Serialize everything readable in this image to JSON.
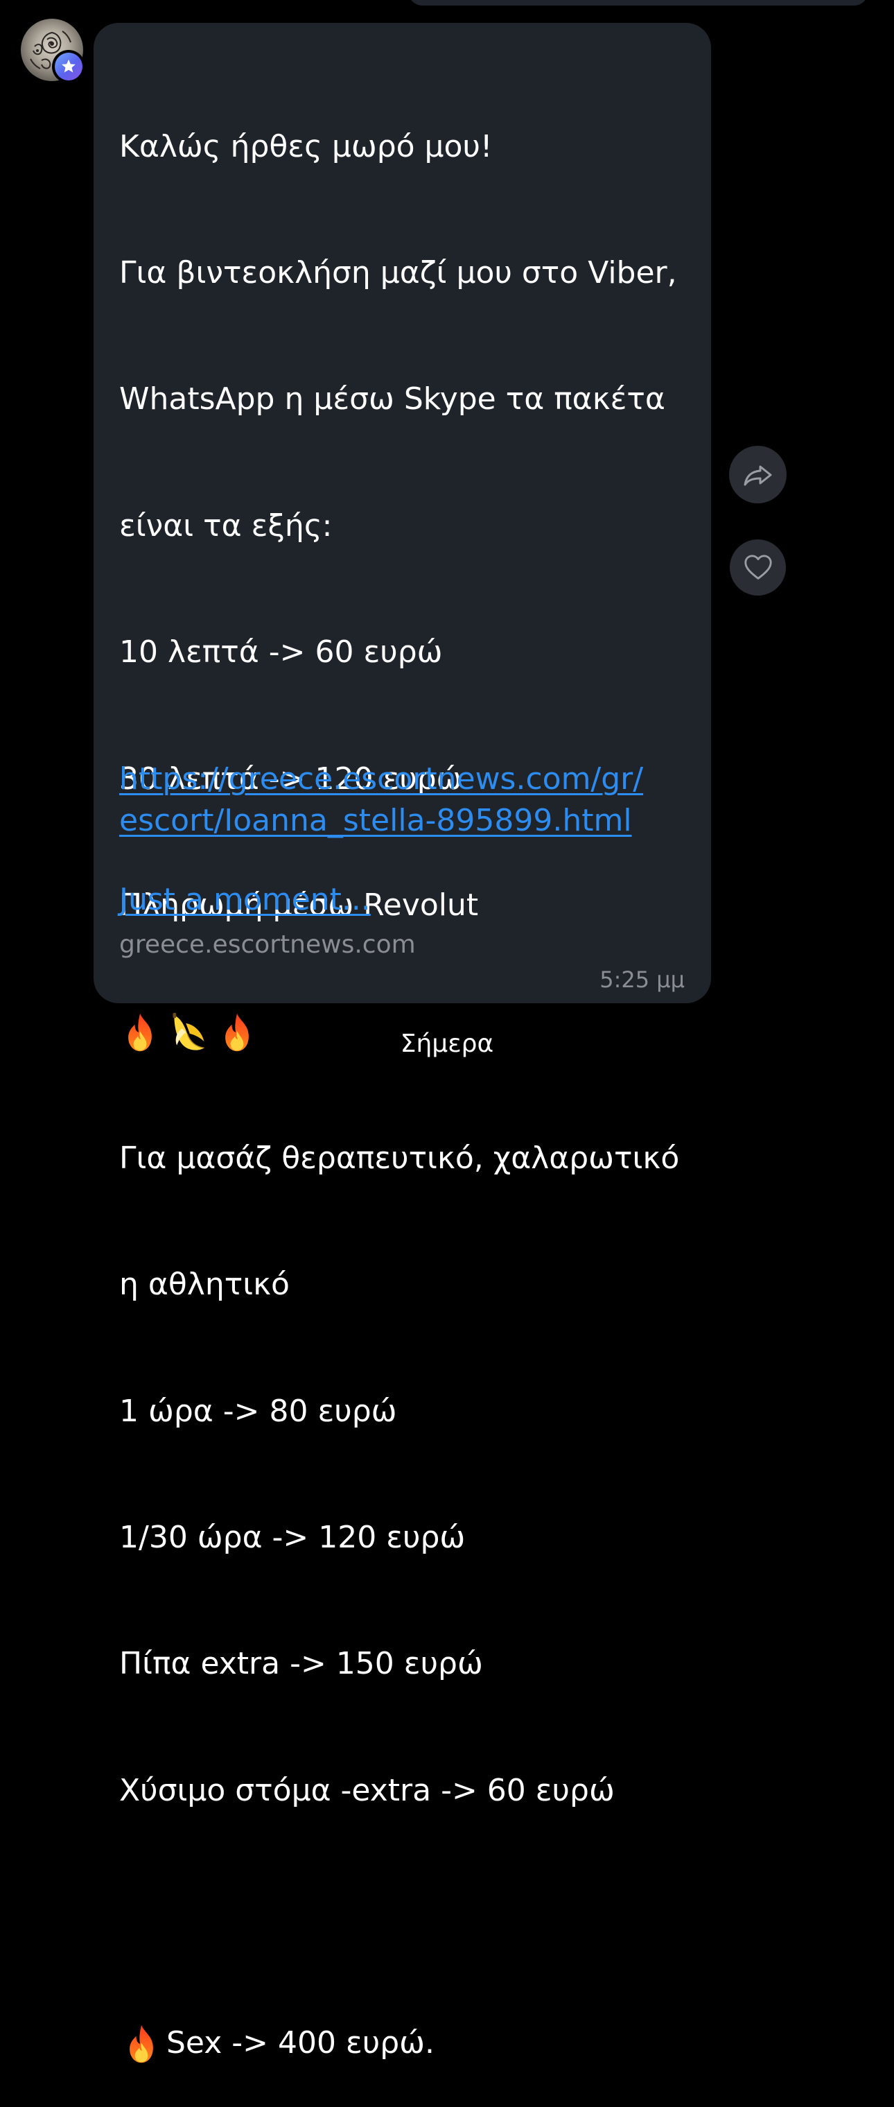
{
  "message": {
    "lines": [
      "Καλώς ήρθες μωρό μου!",
      "Για βιντεοκλήση μαζί μου στο Viber,",
      "WhatsApp η μέσω Skype τα πακέτα",
      "είναι τα εξής:",
      "10 λεπτά -> 60 ευρώ",
      "30 λεπτά -> 120 ευρώ",
      "Πληρωμή μέσω Revolut"
    ],
    "emoji_row": [
      "fire",
      "banana",
      "fire"
    ],
    "lines2": [
      "Για μασάζ θεραπευτικό, χαλαρωτικό",
      "η αθλητικό",
      "1 ώρα -> 80 ευρώ",
      "1/30 ώρα -> 120 ευρώ",
      "Πίπα extra -> 150 ευρώ",
      "Χύσιμο στόμα -extra -> 60 ευρώ"
    ],
    "sex_line": "Sex -> 400 ευρώ.",
    "url_lines": [
      "https://greece.escortnews.com/gr/",
      "escort/Ioanna_stella-895899.html"
    ],
    "preview_title": "Just a moment...",
    "preview_domain": "greece.escortnews.com",
    "timestamp": "5:25 μμ"
  },
  "actions": {
    "share_icon": "share-arrow-icon",
    "like_icon": "heart-icon"
  },
  "date_separator": "Σήμερα",
  "colors": {
    "background": "#000000",
    "bubble": "#1f232a",
    "link": "#2d8cf0",
    "muted_text": "#8a8d92",
    "action_button": "#2a2d33"
  }
}
